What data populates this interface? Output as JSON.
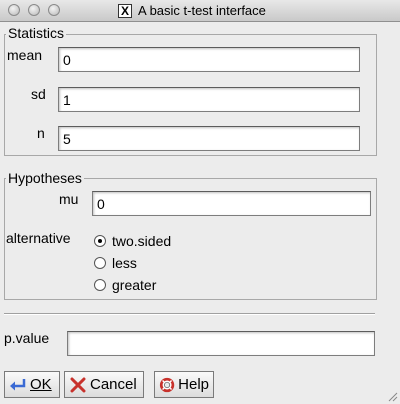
{
  "window": {
    "title": "A basic t-test interface",
    "x_icon": "X"
  },
  "statistics": {
    "legend": "Statistics",
    "mean_label": "mean",
    "mean_value": "0",
    "sd_label": "sd",
    "sd_value": "1",
    "n_label": "n",
    "n_value": "5"
  },
  "hypotheses": {
    "legend": "Hypotheses",
    "mu_label": "mu",
    "mu_value": "0",
    "alternative_label": "alternative",
    "options": [
      "two.sided",
      "less",
      "greater"
    ],
    "selected": "two.sided"
  },
  "result": {
    "pvalue_label": "p.value",
    "pvalue_value": ""
  },
  "buttons": {
    "ok": "OK",
    "cancel": "Cancel",
    "help": "Help"
  },
  "icons": {
    "ok": "enter-arrow-icon",
    "cancel": "cancel-icon",
    "help": "lifebuoy-icon"
  },
  "colors": {
    "window_bg": "#ececec",
    "accent_blue": "#3a6ad4",
    "cancel_red": "#c8322c"
  }
}
